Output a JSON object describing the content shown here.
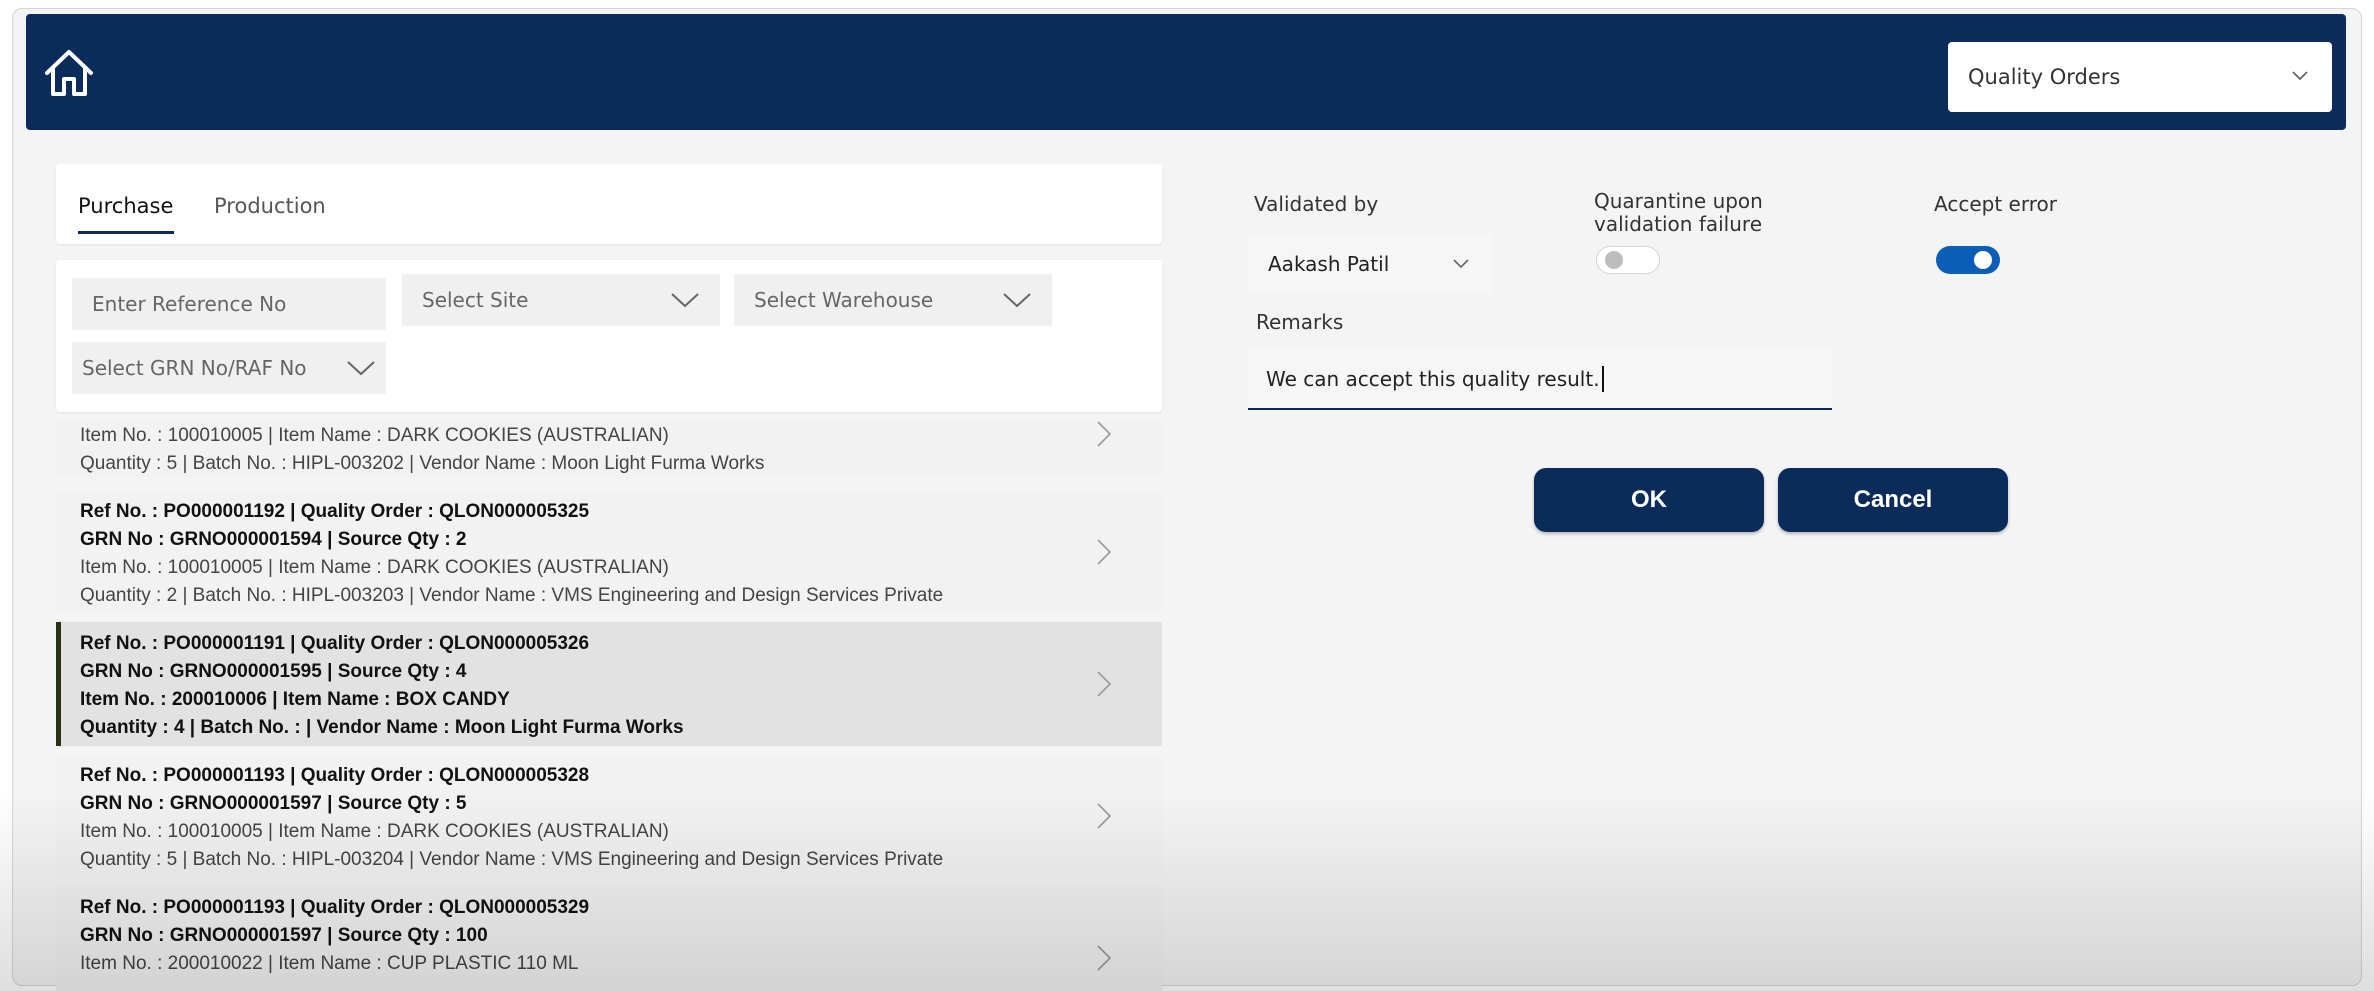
{
  "header": {
    "home_icon": "home-icon",
    "module_select": "Quality Orders"
  },
  "tabs": [
    {
      "label": "Purchase",
      "active": true
    },
    {
      "label": "Production",
      "active": false
    }
  ],
  "filters": {
    "reference_placeholder": "Enter Reference No",
    "site": "Select Site",
    "warehouse": "Select Warehouse",
    "grn": "Select GRN No/RAF No"
  },
  "items": [
    {
      "line3": "Item No. : 100010005 | Item Name : DARK COOKIES (AUSTRALIAN)",
      "line4": "Quantity : 5 | Batch No. : HIPL-003202 | Vendor Name : Moon Light Furma Works"
    },
    {
      "line1": "Ref No. : PO000001192 | Quality Order : QLON000005325",
      "line2": "GRN No : GRNO000001594 | Source Qty : 2",
      "line3": "Item No. : 100010005 | Item Name : DARK COOKIES (AUSTRALIAN)",
      "line4": "Quantity : 2 | Batch No. : HIPL-003203 | Vendor Name : VMS Engineering and Design Services Private"
    },
    {
      "line1": "Ref No. : PO000001191 | Quality Order : QLON000005326",
      "line2": "GRN No : GRNO000001595 | Source Qty : 4",
      "line3": "Item No. : 200010006 | Item Name : BOX CANDY",
      "line4": "Quantity : 4 | Batch No. :  | Vendor Name : Moon Light Furma Works",
      "selected": true
    },
    {
      "line1": "Ref No. : PO000001193 | Quality Order : QLON000005328",
      "line2": "GRN No : GRNO000001597 | Source Qty : 5",
      "line3": "Item No. : 100010005 | Item Name : DARK COOKIES (AUSTRALIAN)",
      "line4": "Quantity : 5 | Batch No. : HIPL-003204 | Vendor Name : VMS Engineering and Design Services Private"
    },
    {
      "line1": "Ref No. : PO000001193 | Quality Order : QLON000005329",
      "line2": "GRN No : GRNO000001597 | Source Qty : 100",
      "line3": "Item No. : 200010022 | Item Name : CUP PLASTIC 110 ML"
    }
  ],
  "form": {
    "validated_by_label": "Validated by",
    "validated_by_value": "Aakash Patil",
    "quarantine_label_1": "Quarantine upon",
    "quarantine_label_2": "validation failure",
    "quarantine_on": false,
    "accept_error_label": "Accept error",
    "accept_error_on": true,
    "remarks_label": "Remarks",
    "remarks_value": "We can accept this quality result."
  },
  "buttons": {
    "ok": "OK",
    "cancel": "Cancel"
  },
  "colors": {
    "header_bg": "#0b2b5a",
    "toggle_on": "#0a5eb8",
    "selected_marker": "#26340f"
  }
}
